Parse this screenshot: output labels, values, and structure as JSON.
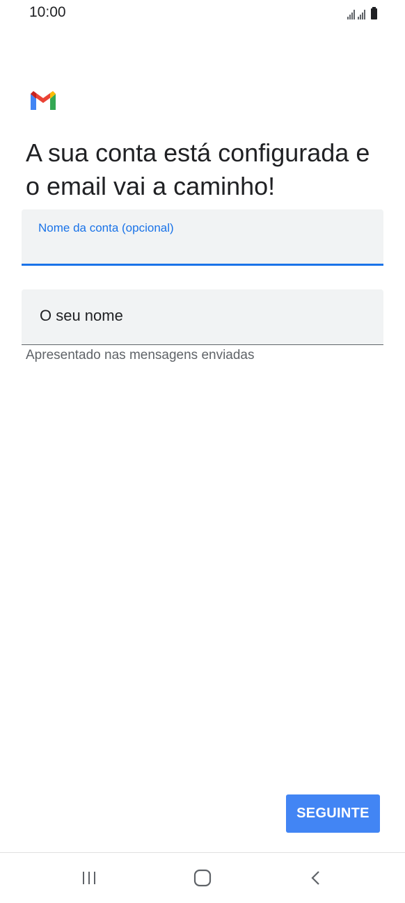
{
  "status_bar": {
    "time": "10:00"
  },
  "app": {
    "logo_icon": "gmail-logo-icon",
    "brand_colors": {
      "blue": "#4285F4",
      "red": "#EA4335",
      "yellow": "#FBBC04",
      "green": "#34A853"
    }
  },
  "headline": "A sua conta está configurada e o email vai a caminho!",
  "form": {
    "account_name": {
      "label": "Nome da conta (opcional)",
      "value": ""
    },
    "your_name": {
      "placeholder": "O seu nome",
      "value": "",
      "helper": "Apresentado nas mensagens enviadas"
    }
  },
  "actions": {
    "next_label": "SEGUINTE"
  },
  "nav_bar": {
    "recent_icon": "recent-apps-icon",
    "home_icon": "home-icon",
    "back_icon": "back-icon"
  },
  "colors": {
    "accent": "#1a73e8",
    "button": "#4285f4",
    "field_bg": "#f1f3f4"
  }
}
